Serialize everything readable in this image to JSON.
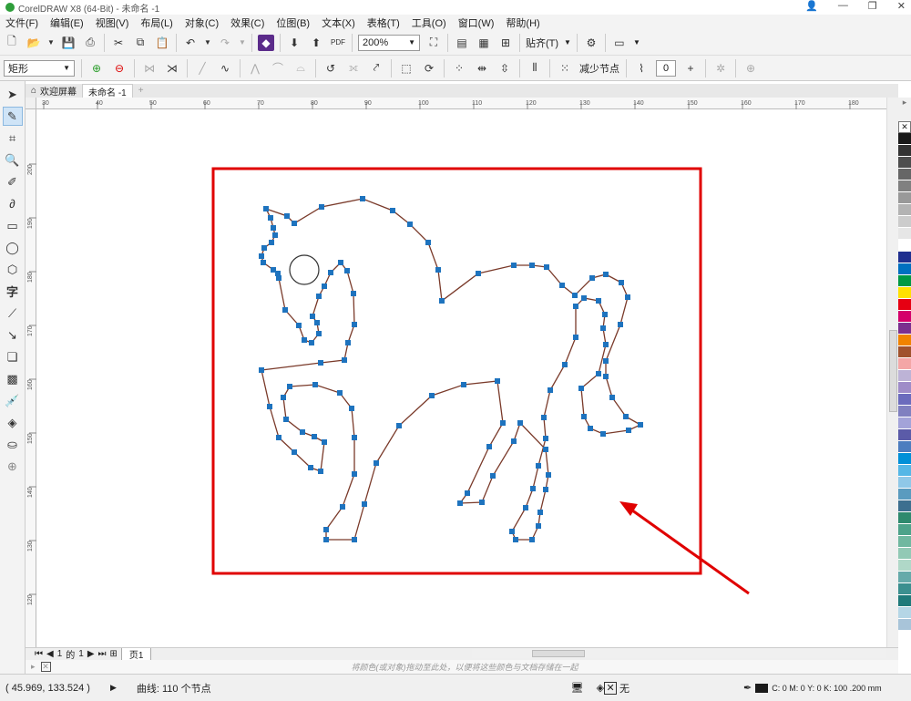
{
  "window": {
    "title": "CorelDRAW X8 (64-Bit) - 未命名 -1"
  },
  "menu": [
    "文件(F)",
    "编辑(E)",
    "视图(V)",
    "布局(L)",
    "对象(C)",
    "效果(C)",
    "位图(B)",
    "文本(X)",
    "表格(T)",
    "工具(O)",
    "窗口(W)",
    "帮助(H)"
  ],
  "toolbar": {
    "zoom_value": "200%",
    "snap_label": "贴齐(T)",
    "pdf_label": "PDF"
  },
  "propertybar": {
    "shape_select": "矩形",
    "reduce_nodes_label": "减少节点",
    "smoothness_value": "0"
  },
  "tabs": {
    "welcome_label": "欢迎屏幕",
    "doc_label": "未命名 -1"
  },
  "ruler": {
    "h_ticks": [
      "30",
      "40",
      "50",
      "60",
      "70",
      "80",
      "90",
      "100",
      "110",
      "120",
      "130",
      "140",
      "150",
      "160",
      "170",
      "180"
    ],
    "v_ticks": [
      "200",
      "190",
      "180",
      "170",
      "160",
      "150",
      "140",
      "130",
      "120"
    ]
  },
  "pagenav": {
    "current": "1",
    "of_label": "的",
    "total": "1",
    "page_tab": "页1"
  },
  "hint": "将颜色(或对象)拖动至此处，以便将这些颜色与文档存储在一起",
  "status": {
    "coords": "( 45.969, 133.524 )",
    "object_info": "曲线: 110 个节点",
    "fill_label": "无",
    "outline_info": "C: 0 M: 0 Y: 0 K: 100  .200 mm"
  },
  "palette_colors": [
    "#ffffff",
    "#1a1a1a",
    "#333333",
    "#4d4d4d",
    "#666666",
    "#808080",
    "#999999",
    "#b3b3b3",
    "#cccccc",
    "#e6e6e6",
    "#ffffff",
    "#1f2f8f",
    "#0070c0",
    "#009944",
    "#ffe100",
    "#e60012",
    "#d4006b",
    "#7b2f8f",
    "#f08300",
    "#a0522d",
    "#f4a6a6",
    "#bdb3d6",
    "#9f8cc8",
    "#6b6bbd",
    "#8080c0",
    "#a3a3d9",
    "#5b5ba8",
    "#4d7dbf",
    "#0090d8",
    "#55b7e6",
    "#8fc8e8",
    "#5a9bbf",
    "#3d6f8f",
    "#2e8a6e",
    "#4da38a",
    "#70b8a0",
    "#92c9b5",
    "#b0d8c8",
    "#66aaaa",
    "#3b8f8f",
    "#1f7a7a",
    "#b5d6e6",
    "#a8c4d9"
  ],
  "accent": {
    "highlight_red": "#e00000",
    "node_blue": "#1e73be",
    "path_brown": "#7a3a2a"
  }
}
